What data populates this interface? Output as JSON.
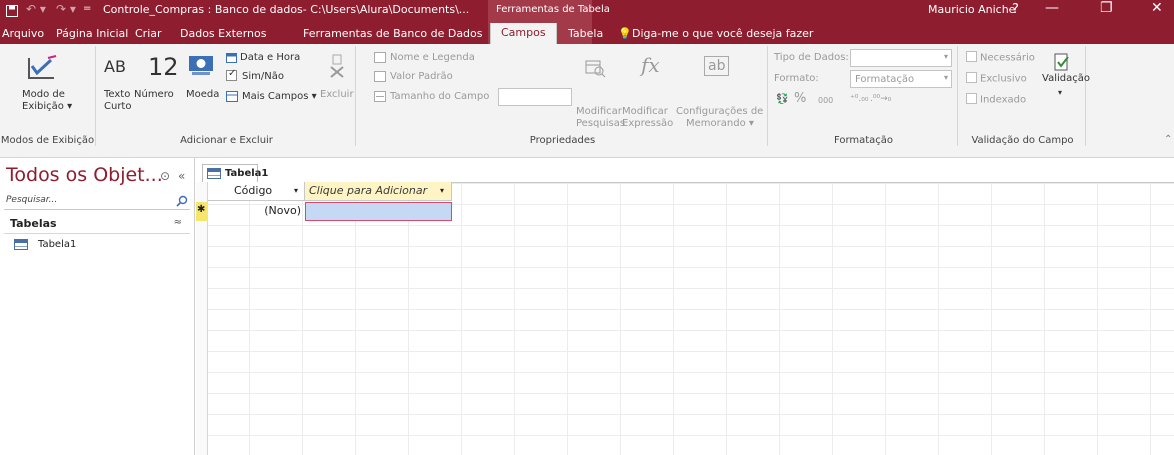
{
  "titlebar": {
    "document_title": "Controle_Compras : Banco de dados- C:\\Users\\Alura\\Documents\\...",
    "context_title": "Ferramentas de Tabela",
    "user": "Mauricio Aniche",
    "help": "?",
    "minimize": "—",
    "restore": "❐",
    "close": "✕",
    "qat_icons": [
      "save-icon",
      "undo-icon",
      "redo-icon",
      "customize-icon"
    ]
  },
  "menu": [
    "Arquivo",
    "Página Inicial",
    "Criar",
    "Dados Externos",
    "Ferramentas de Banco de Dados",
    "Campos",
    "Tabela"
  ],
  "tellme": "Diga-me o que você deseja fazer",
  "ribbon": {
    "view": {
      "label1": "Modo de",
      "label2": "Exibição ▾",
      "group": "Modos de Exibição"
    },
    "add": {
      "texto_glyph": "AB",
      "texto1": "Texto",
      "texto2": "Curto",
      "numero_glyph": "12",
      "numero": "Número",
      "moeda": "Moeda",
      "data_hora": "Data e Hora",
      "sim_nao": "Sim/Não",
      "mais": "Mais Campos ▾",
      "excluir": "Excluir",
      "group": "Adicionar e Excluir"
    },
    "props": {
      "nome": "Nome e Legenda",
      "valor": "Valor Padrão",
      "tamanho": "Tamanho do Campo",
      "mod_pesq1": "Modificar",
      "mod_pesq2": "Pesquisas",
      "mod_expr1": "Modificar",
      "mod_expr2": "Expressão",
      "fx": "fx",
      "conf1": "Configurações de",
      "conf2": "Memorando ▾",
      "ab": "ab",
      "group": "Propriedades"
    },
    "format": {
      "tipo": "Tipo de Dados:",
      "formato": "Formato:",
      "formatacao": "Formatação",
      "pct": "%",
      "thousands": "000",
      "group": "Formatação"
    },
    "valid": {
      "necessario": "Necessário",
      "exclusivo": "Exclusivo",
      "indexado": "Indexado",
      "validacao": "Validação",
      "group": "Validação do Campo"
    }
  },
  "nav": {
    "title": "Todos os Objet...",
    "search_placeholder": "Pesquisar...",
    "section": "Tabelas",
    "items": [
      "Tabela1"
    ]
  },
  "doc": {
    "tab": "Tabela1",
    "columns": [
      "Código",
      "Clique para Adicionar"
    ],
    "new_row_marker": "✱",
    "new_row_value": "(Novo)"
  }
}
